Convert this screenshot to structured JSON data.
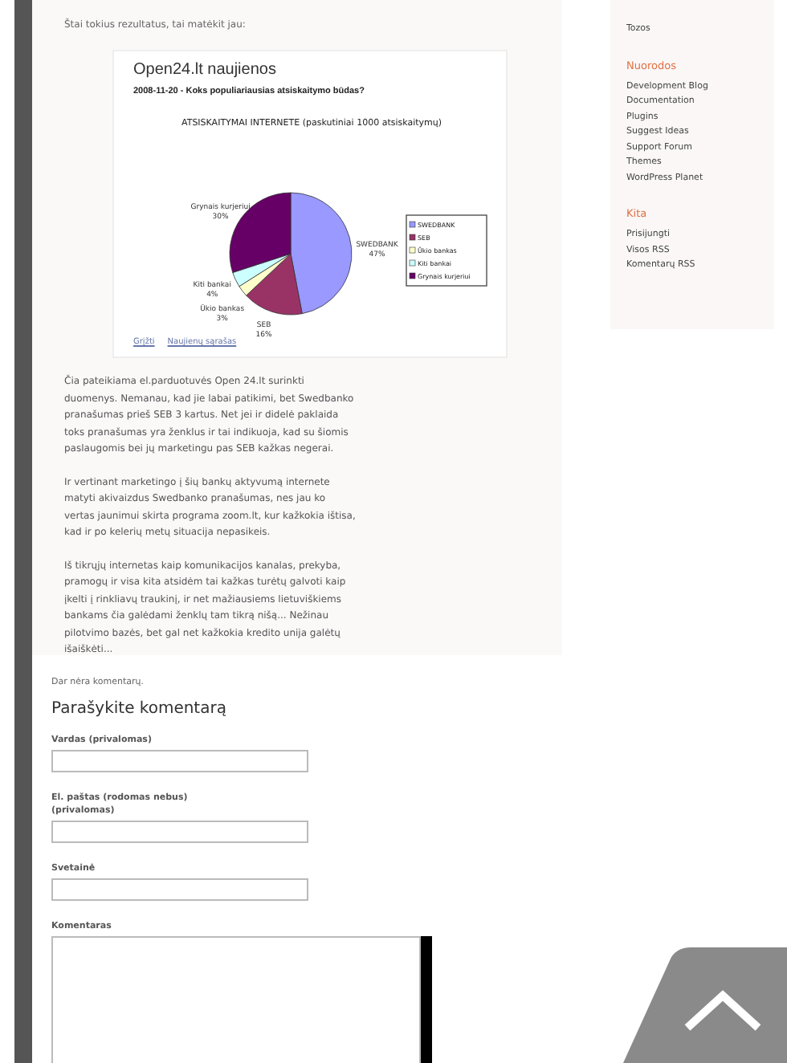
{
  "post": {
    "intro": "Štai tokius rezultatus, tai matėkit jau:",
    "embed": {
      "site_title": "Open24.lt naujienos",
      "headline": "2008-11-20 - Koks populiariausias atsiskaitymo būdas?",
      "chart_data": {
        "type": "pie",
        "title": "ATSISKAITYMAI INTERNETE (paskutiniai 1000 atsiskaitymų)",
        "categories": [
          "SWEDBANK",
          "SEB",
          "Ūkio bankas",
          "Kiti bankai",
          "Grynais kurjeriui"
        ],
        "values": [
          47,
          16,
          3,
          4,
          30
        ],
        "legend": "right",
        "colors": [
          "#9999ff",
          "#993366",
          "#ffffcc",
          "#ccffff",
          "#660066"
        ],
        "value_labels": [
          "47%",
          "16%",
          "3%",
          "4%",
          "30%"
        ]
      },
      "links": [
        "Grįžti",
        "Naujienų sąrašas"
      ]
    },
    "paragraphs": [
      "Čia pateikiama el.parduotuvės Open 24.lt surinkti duomenys. Nemanau, kad jie labai patikimi, bet Swedbanko pranašumas prieš SEB 3 kartus. Net jei ir didelė paklaida toks pranašumas yra ženklus ir tai indikuoja, kad su šiomis paslaugomis bei jų marketingu pas SEB kažkas negerai.",
      "Ir vertinant marketingo į šių bankų aktyvumą internete matyti akivaizdus Swedbanko pranašumas, nes jau ko vertas jaunimui skirta programa zoom.lt, kur kažkokia ištisa, kad ir po kelerių metų situacija nepasikeis.",
      "Iš tikrųjų internetas kaip komunikacijos kanalas, prekyba, pramogų ir visa kita atsidėm tai kažkas turėtų galvoti kaip įkelti į rinkliavų traukinį, ir net mažiausiems lietuviškiems bankams čia galėdami ženklų tam tikrą nišą... Nežinau pilotvimo bazės, bet gal net kažkokia kredito unija galėtų išaiškėti..."
    ]
  },
  "comments": {
    "status": "Dar nėra komentarų.",
    "heading": "Parašykite komentarą",
    "fields": [
      {
        "label": "Vardas (privalomas)",
        "kind": "input"
      },
      {
        "label": "El. paštas (rodomas nebus) (privalomas)",
        "kind": "input"
      },
      {
        "label": "Svetainė",
        "kind": "input"
      },
      {
        "label": "Komentaras",
        "kind": "textarea"
      }
    ]
  },
  "sidebar": {
    "top_item": "Tozos",
    "sections": [
      {
        "title": "Nuorodos",
        "links": [
          "Development Blog",
          "Documentation",
          "Plugins",
          "Suggest Ideas",
          "Support Forum",
          "Themes",
          "WordPress Planet"
        ]
      },
      {
        "title": "Kita",
        "links": [
          "Prisijungti",
          "Visos RSS",
          "Komentarų RSS"
        ]
      }
    ]
  }
}
